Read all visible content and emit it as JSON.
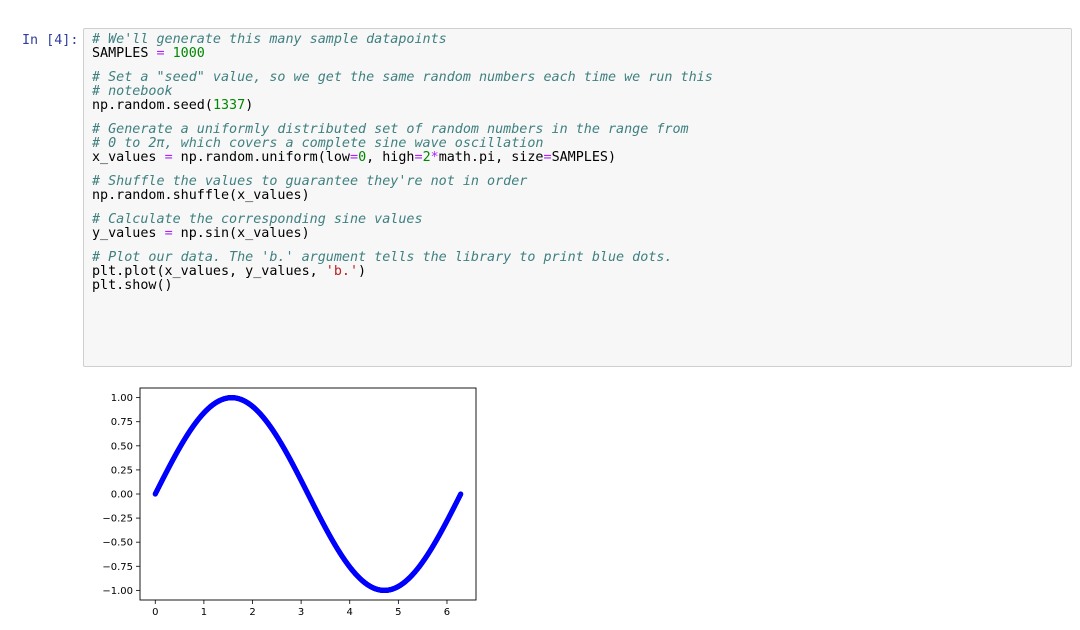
{
  "cell": {
    "prompt": "In [4]:",
    "lines": [
      [
        {
          "t": "# We'll generate this many sample datapoints",
          "k": "c"
        }
      ],
      [
        {
          "t": "SAMPLES ",
          "k": ""
        },
        {
          "t": "=",
          "k": "o"
        },
        {
          "t": " ",
          "k": ""
        },
        {
          "t": "1000",
          "k": "n"
        }
      ],
      null,
      [
        {
          "t": "# Set a \"seed\" value, so we get the same random numbers each time we run this",
          "k": "c"
        }
      ],
      [
        {
          "t": "# notebook",
          "k": "c"
        }
      ],
      [
        {
          "t": "np.random.seed(",
          "k": ""
        },
        {
          "t": "1337",
          "k": "n"
        },
        {
          "t": ")",
          "k": ""
        }
      ],
      null,
      [
        {
          "t": "# Generate a uniformly distributed set of random numbers in the range from",
          "k": "c"
        }
      ],
      [
        {
          "t": "# 0 to 2π, which covers a complete sine wave oscillation",
          "k": "c"
        }
      ],
      [
        {
          "t": "x_values ",
          "k": ""
        },
        {
          "t": "=",
          "k": "o"
        },
        {
          "t": " np.random.uniform(low",
          "k": ""
        },
        {
          "t": "=",
          "k": "o"
        },
        {
          "t": "0",
          "k": "n"
        },
        {
          "t": ", high",
          "k": ""
        },
        {
          "t": "=",
          "k": "o"
        },
        {
          "t": "2",
          "k": "n"
        },
        {
          "t": "*",
          "k": "o"
        },
        {
          "t": "math.pi, size",
          "k": ""
        },
        {
          "t": "=",
          "k": "o"
        },
        {
          "t": "SAMPLES)",
          "k": ""
        }
      ],
      null,
      [
        {
          "t": "# Shuffle the values to guarantee they're not in order",
          "k": "c"
        }
      ],
      [
        {
          "t": "np.random.shuffle(x_values)",
          "k": ""
        }
      ],
      null,
      [
        {
          "t": "# Calculate the corresponding sine values",
          "k": "c"
        }
      ],
      [
        {
          "t": "y_values ",
          "k": ""
        },
        {
          "t": "=",
          "k": "o"
        },
        {
          "t": " np.sin(x_values)",
          "k": ""
        }
      ],
      null,
      [
        {
          "t": "# Plot our data. The 'b.' argument tells the library to print blue dots.",
          "k": "c"
        }
      ],
      [
        {
          "t": "plt.plot(x_values, y_values, ",
          "k": ""
        },
        {
          "t": "'b.'",
          "k": "s"
        },
        {
          "t": ")",
          "k": ""
        }
      ],
      [
        {
          "t": "plt.show()",
          "k": ""
        }
      ]
    ]
  },
  "chart_data": {
    "type": "scatter",
    "marker_color": "#0000ff",
    "function": "sin",
    "x_range": [
      0,
      6.283
    ],
    "xlim": [
      -0.314,
      6.597
    ],
    "ylim": [
      -1.1,
      1.1
    ],
    "xticks": [
      "0",
      "1",
      "2",
      "3",
      "4",
      "5",
      "6"
    ],
    "yticks": [
      "1.00",
      "0.75",
      "0.50",
      "0.25",
      "0.00",
      "−0.25",
      "−0.50",
      "−0.75",
      "−1.00"
    ],
    "num_points": 1000,
    "grid": false
  }
}
